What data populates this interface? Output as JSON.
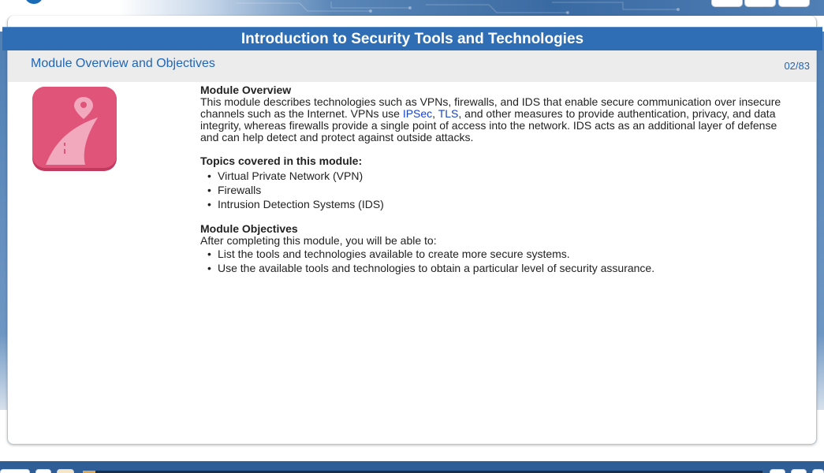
{
  "header": {
    "title": "Introduction to Security Tools and Technologies"
  },
  "subheader": {
    "title": "Module Overview and Objectives",
    "page_indicator": "02/83"
  },
  "icon": {
    "name": "map-pin-road-icon",
    "color": "#e0547a"
  },
  "overview": {
    "heading": "Module Overview",
    "text_1": "This module describes technologies such as VPNs, firewalls, and IDS that enable secure communication over insecure channels such as the Internet. VPNs use ",
    "link_ipsec": "IPSec",
    "sep": ", ",
    "link_tls": "TLS",
    "text_2": ", and other measures to provide authentication, privacy, and data integrity, whereas firewalls provide a single point of access into the network. IDS acts as an additional layer of defense and can help detect and protect against outside attacks."
  },
  "topics": {
    "heading": "Topics covered in this module:",
    "items": [
      "Virtual Private Network (VPN)",
      "Firewalls",
      "Intrusion Detection Systems (IDS)"
    ]
  },
  "objectives": {
    "heading": "Module Objectives",
    "intro": "After completing this module, you will be able to:",
    "items": [
      "List the tools and technologies available to create more secure systems.",
      "Use the available tools and technologies to obtain a particular level of security assurance."
    ]
  },
  "progress": {
    "fraction": 0.018
  },
  "colors": {
    "accent": "#2f6db4",
    "link": "#1a44c6",
    "subhead_text": "#1f66b8"
  }
}
